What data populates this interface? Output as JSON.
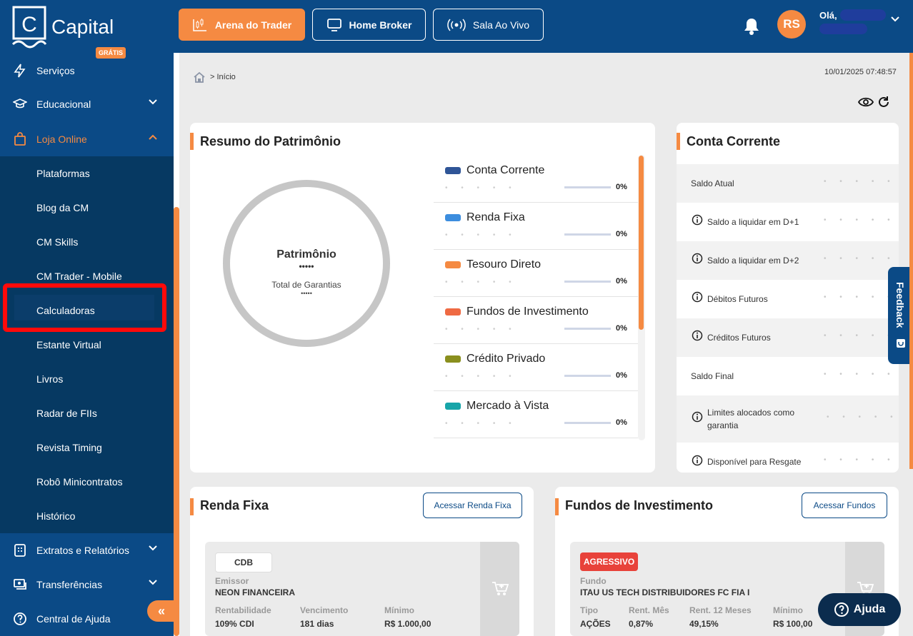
{
  "brand": {
    "name": "Capital"
  },
  "topnav": {
    "arena": "Arena do Trader",
    "home_broker": "Home Broker",
    "sala": "Sala Ao Vivo"
  },
  "user": {
    "initials": "RS",
    "greeting": "Olá,"
  },
  "sidebar": {
    "items": [
      {
        "label": "Serviços",
        "icon": "bolt-icon"
      },
      {
        "label": "Educacional",
        "badge": "GRÁTIS",
        "icon": "graduation-cap-icon"
      },
      {
        "label": "Loja Online",
        "icon": "shopping-bag-icon"
      },
      {
        "label": "Plataformas"
      },
      {
        "label": "Blog da CM"
      },
      {
        "label": "CM Skills"
      },
      {
        "label": "CM Trader - Mobile"
      },
      {
        "label": "Calculadoras"
      },
      {
        "label": "Estante Virtual"
      },
      {
        "label": "Livros"
      },
      {
        "label": "Radar de FIIs"
      },
      {
        "label": "Revista Timing"
      },
      {
        "label": "Robô Minicontratos"
      },
      {
        "label": "Histórico"
      },
      {
        "label": "Extratos e Relatórios",
        "icon": "report-icon"
      },
      {
        "label": "Transferências",
        "icon": "transfer-icon"
      },
      {
        "label": "Central de Ajuda",
        "icon": "help-circle-icon"
      }
    ],
    "collapse": "«"
  },
  "breadcrumb": {
    "current": "> Início"
  },
  "timestamp": "10/01/2025 07:48:57",
  "patrimonio": {
    "title": "Resumo do Patrimônio",
    "center_title": "Patrimônio",
    "center_value": "•••••",
    "garantias_label": "Total de Garantias",
    "garantias_value": "•••••",
    "masked_dots": "• • • • •",
    "allocations": [
      {
        "name": "Conta Corrente",
        "color": "#2f5597",
        "pct": "0%"
      },
      {
        "name": "Renda Fixa",
        "color": "#3c8dde",
        "pct": "0%"
      },
      {
        "name": "Tesouro Direto",
        "color": "#f58a42",
        "pct": "0%"
      },
      {
        "name": "Fundos de Investimento",
        "color": "#ef6a43",
        "pct": "0%"
      },
      {
        "name": "Crédito Privado",
        "color": "#8a8f1e",
        "pct": "0%"
      },
      {
        "name": "Mercado à Vista",
        "color": "#17a5a9",
        "pct": "0%"
      }
    ]
  },
  "conta_corrente": {
    "title": "Conta Corrente",
    "rows": [
      {
        "label": "Saldo Atual",
        "info": false
      },
      {
        "label": "Saldo a liquidar em D+1",
        "info": true
      },
      {
        "label": "Saldo a liquidar em D+2",
        "info": true
      },
      {
        "label": "Débitos Futuros",
        "info": true
      },
      {
        "label": "Créditos Futuros",
        "info": true
      },
      {
        "label": "Saldo Final",
        "info": false
      },
      {
        "label": "Limites alocados como",
        "label2": "garantia",
        "info": true
      },
      {
        "label": "Disponível para Resgate",
        "info": true
      }
    ],
    "masked_dots": "• • • • •"
  },
  "renda_fixa": {
    "title": "Renda Fixa",
    "button": "Acessar Renda Fixa",
    "product": {
      "tag": "CDB",
      "emissor_label": "Emissor",
      "emissor": "NEON FINANCEIRA",
      "rent_label": "Rentabilidade",
      "rent": "109% CDI",
      "venc_label": "Vencimento",
      "venc": "181 dias",
      "min_label": "Mínimo",
      "min": "R$ 1.000,00"
    }
  },
  "fundos": {
    "title": "Fundos de Investimento",
    "button": "Acessar Fundos",
    "product": {
      "tag": "AGRESSIVO",
      "fundo_label": "Fundo",
      "fundo": "ITAU US TECH DISTRIBUIDORES FC FIA I",
      "tipo_label": "Tipo",
      "tipo": "AÇÕES",
      "rm_label": "Rent. Mês",
      "rm": "0,87%",
      "r12_label": "Rent. 12 Meses",
      "r12": "49,15%",
      "min_label": "Mínimo",
      "min": "R$ 100,00"
    }
  },
  "feedback": "Feedback",
  "help": "Ajuda"
}
